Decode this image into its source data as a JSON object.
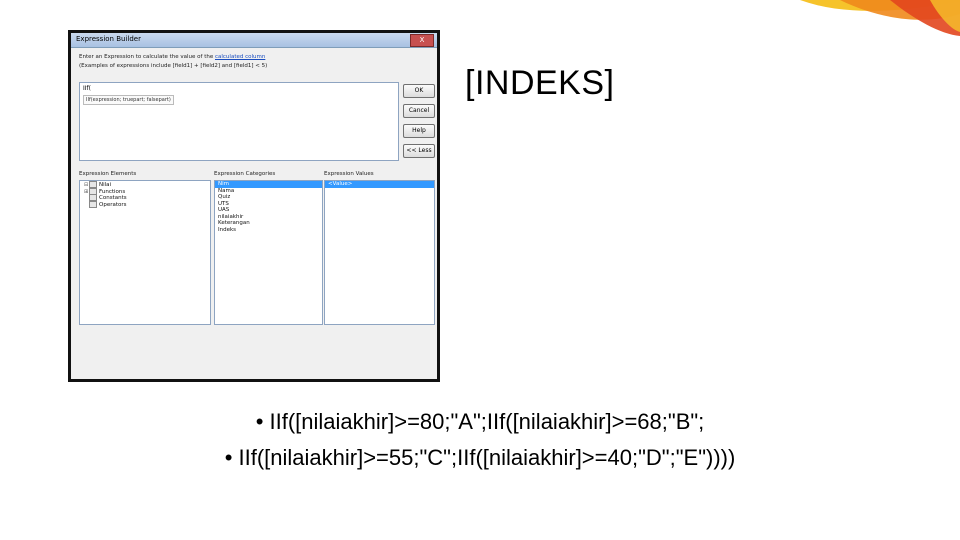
{
  "dialog": {
    "title": "Expression Builder",
    "close_label": "X",
    "instruction_line1_prefix": "Enter an Expression to calculate the value of the ",
    "instruction_link": "calculated column",
    "instruction_line2": "(Examples of expressions include [field1] + [field2] and [field1] < 5)",
    "expression_text": "IIf(",
    "expression_tooltip": "IIf(expression; truepart; falsepart)",
    "buttons": {
      "ok": "OK",
      "cancel": "Cancel",
      "help": "Help",
      "less": "<< Less"
    },
    "labels": {
      "elements": "Expression Elements",
      "categories": "Expression Categories",
      "values": "Expression Values"
    },
    "elements": [
      "Nilai",
      "Functions",
      "Constants",
      "Operators"
    ],
    "categories": [
      "Nim",
      "Nama",
      "Quiz",
      "UTS",
      "UAS",
      "nilaiakhir",
      "Keterangan",
      "Indeks"
    ],
    "values": [
      "<Value>"
    ]
  },
  "slide": {
    "heading": "[INDEKS]",
    "bullets": [
      "• IIf([nilaiakhir]>=80;\"A\";IIf([nilaiakhir]>=68;\"B\";",
      "• IIf([nilaiakhir]>=55;\"C\";IIf([nilaiakhir]>=40;\"D\";\"E\"))))"
    ]
  },
  "colors": {
    "accent_orange": "#f08a1c",
    "accent_yellow": "#f6c32b",
    "accent_red": "#e2461e"
  }
}
